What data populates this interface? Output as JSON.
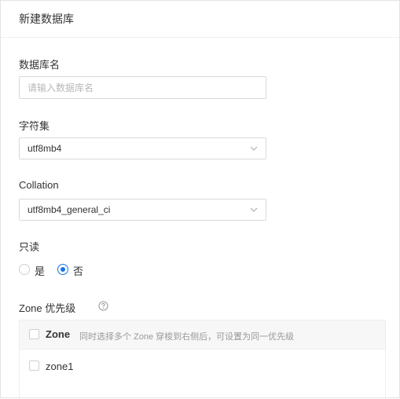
{
  "dialog": {
    "title": "新建数据库"
  },
  "form": {
    "db_name": {
      "label": "数据库名",
      "placeholder": "请输入数据库名",
      "value": ""
    },
    "charset": {
      "label": "字符集",
      "value": "utf8mb4",
      "icon": "chevron-down-icon"
    },
    "collation": {
      "label": "Collation",
      "value": "utf8mb4_general_ci",
      "icon": "chevron-down-icon"
    },
    "readonly": {
      "label": "只读",
      "options": [
        {
          "label": "是",
          "checked": false
        },
        {
          "label": "否",
          "checked": true
        }
      ]
    },
    "zone_priority": {
      "label": "Zone 优先级",
      "help_icon": "question-circle-icon",
      "header_label": "Zone",
      "hint": "同时选择多个 Zone 穿梭到右侧后，可设置为同一优先级",
      "zones": [
        {
          "name": "zone1",
          "checked": false
        }
      ]
    }
  },
  "colors": {
    "accent": "#1a73e8",
    "border": "#d9d9d9",
    "text": "#333333",
    "placeholder": "#b8b8b8",
    "table_header_bg": "#f7f7f7"
  }
}
